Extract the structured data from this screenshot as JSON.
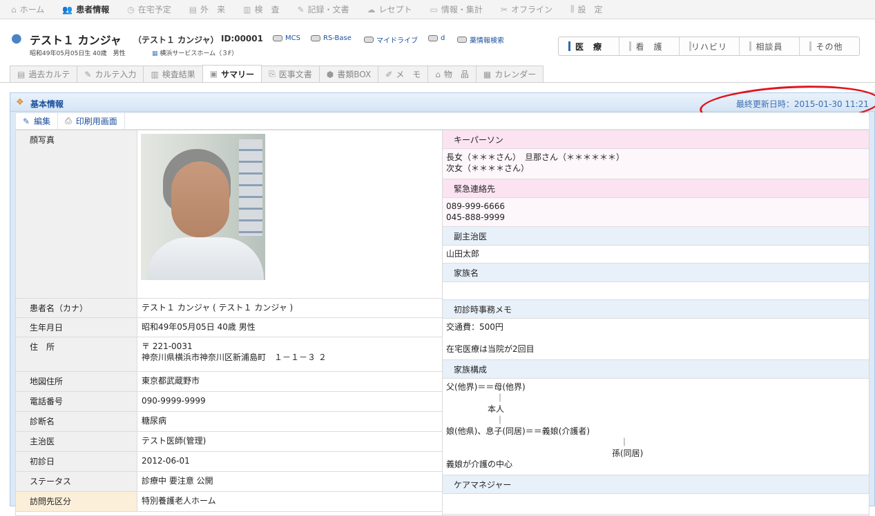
{
  "top_nav": [
    {
      "label": "ホーム",
      "icon": "home-icon",
      "glyph": "⌂",
      "active": false
    },
    {
      "label": "患者情報",
      "icon": "users-icon",
      "glyph": "👥",
      "active": true
    },
    {
      "label": "在宅予定",
      "icon": "clock-icon",
      "glyph": "◷",
      "active": false
    },
    {
      "label": "外　来",
      "icon": "clinic-icon",
      "glyph": "▤",
      "active": false
    },
    {
      "label": "検　査",
      "icon": "chart-icon",
      "glyph": "▥",
      "active": false
    },
    {
      "label": "記録・文書",
      "icon": "document-icon",
      "glyph": "✎",
      "active": false
    },
    {
      "label": "レセプト",
      "icon": "cloud-icon",
      "glyph": "☁",
      "active": false
    },
    {
      "label": "情報・集計",
      "icon": "monitor-icon",
      "glyph": "▭",
      "active": false
    },
    {
      "label": "オフライン",
      "icon": "offline-icon",
      "glyph": "✂",
      "active": false
    },
    {
      "label": "設　定",
      "icon": "settings-icon",
      "glyph": "⫼",
      "active": false
    }
  ],
  "patient": {
    "name": "テスト１ カンジャ",
    "kana": "（テスト１ カンジャ）",
    "id": "ID:00001",
    "info": "昭和49年05月05日生 40歳　男性",
    "facility": "横浜サービスホーム（３F）"
  },
  "services": [
    "MCS",
    "RS-Base",
    "マイドライブ",
    "d",
    "薬情報検索"
  ],
  "roles": [
    {
      "label": "医　療",
      "active": true
    },
    {
      "label": "看　護",
      "active": false
    },
    {
      "label": "リハビリ",
      "active": false
    },
    {
      "label": "相談員",
      "active": false
    },
    {
      "label": "その他",
      "active": false
    }
  ],
  "tabs": [
    {
      "label": "過去カルテ",
      "icon": "history-icon",
      "glyph": "▤",
      "active": false
    },
    {
      "label": "カルテ入力",
      "icon": "edit-icon",
      "glyph": "✎",
      "active": false
    },
    {
      "label": "検査結果",
      "icon": "chart-icon",
      "glyph": "▥",
      "active": false
    },
    {
      "label": "サマリー",
      "icon": "summary-icon",
      "glyph": "▣",
      "active": true
    },
    {
      "label": "医事文書",
      "icon": "pdf-icon",
      "glyph": "⎘",
      "active": false
    },
    {
      "label": "書類BOX",
      "icon": "box-icon",
      "glyph": "⬢",
      "active": false
    },
    {
      "label": "メ　モ",
      "icon": "memo-icon",
      "glyph": "✐",
      "active": false
    },
    {
      "label": "物　品",
      "icon": "item-icon",
      "glyph": "⌂",
      "active": false
    },
    {
      "label": "カレンダー",
      "icon": "calendar-icon",
      "glyph": "▦",
      "active": false
    }
  ],
  "panel": {
    "title": "基本情報",
    "updated": "最終更新日時：2015-01-30 11:21",
    "toolbar": {
      "edit": "編集",
      "print": "印刷用画面"
    }
  },
  "left_rows": [
    {
      "label": "顔写真",
      "value": ""
    },
    {
      "label": "患者名（カナ）",
      "value": "テスト１ カンジャ ( テスト１ カンジャ )"
    },
    {
      "label": "生年月日",
      "value": "昭和49年05月05日 40歳 男性"
    },
    {
      "label": "住　所",
      "value": "〒 221-0031\n神奈川県横浜市神奈川区新浦島町　１－１－３ ２"
    },
    {
      "label": "地図住所",
      "value": "東京都武蔵野市"
    },
    {
      "label": "電話番号",
      "value": "090-9999-9999"
    },
    {
      "label": "診断名",
      "value": "糖尿病"
    },
    {
      "label": "主治医",
      "value": "テスト医師(管理)"
    },
    {
      "label": "初診日",
      "value": "2012-06-01"
    },
    {
      "label": "ステータス",
      "value": "診療中 要注意 公開"
    },
    {
      "label": "訪問先区分",
      "value": "特別養護老人ホーム"
    }
  ],
  "right_sections": [
    {
      "title": "キーパーソン",
      "style": "pink",
      "body": "長女（＊＊＊さん）　旦那さん（＊＊＊＊＊＊）\n次女（＊＊＊＊さん）"
    },
    {
      "title": "緊急連絡先",
      "style": "pink",
      "body": "089-999-6666\n045-888-9999"
    },
    {
      "title": "副主治医",
      "style": "blue",
      "body": "山田太郎"
    },
    {
      "title": "家族名",
      "style": "blue",
      "body": ""
    },
    {
      "title": "初診時事務メモ",
      "style": "blue",
      "body": "交通費：500円\n\n在宅医療は当院が2回目"
    },
    {
      "title": "家族構成",
      "style": "blue",
      "body": "父(他界)＝＝母(他界)\n　　　　　　｜\n　　　　　本人\n　　　　　　｜\n娘(他県)、息子(同居)＝＝義娘(介護者)\n　　　　　　　　　　　　　　　　　　　　　｜\n　　　　　　　　　　　　　　　　　　　　孫(同居)\n義娘が介護の中心"
    },
    {
      "title": "ケアマネジャー",
      "style": "blue",
      "body": ""
    }
  ]
}
